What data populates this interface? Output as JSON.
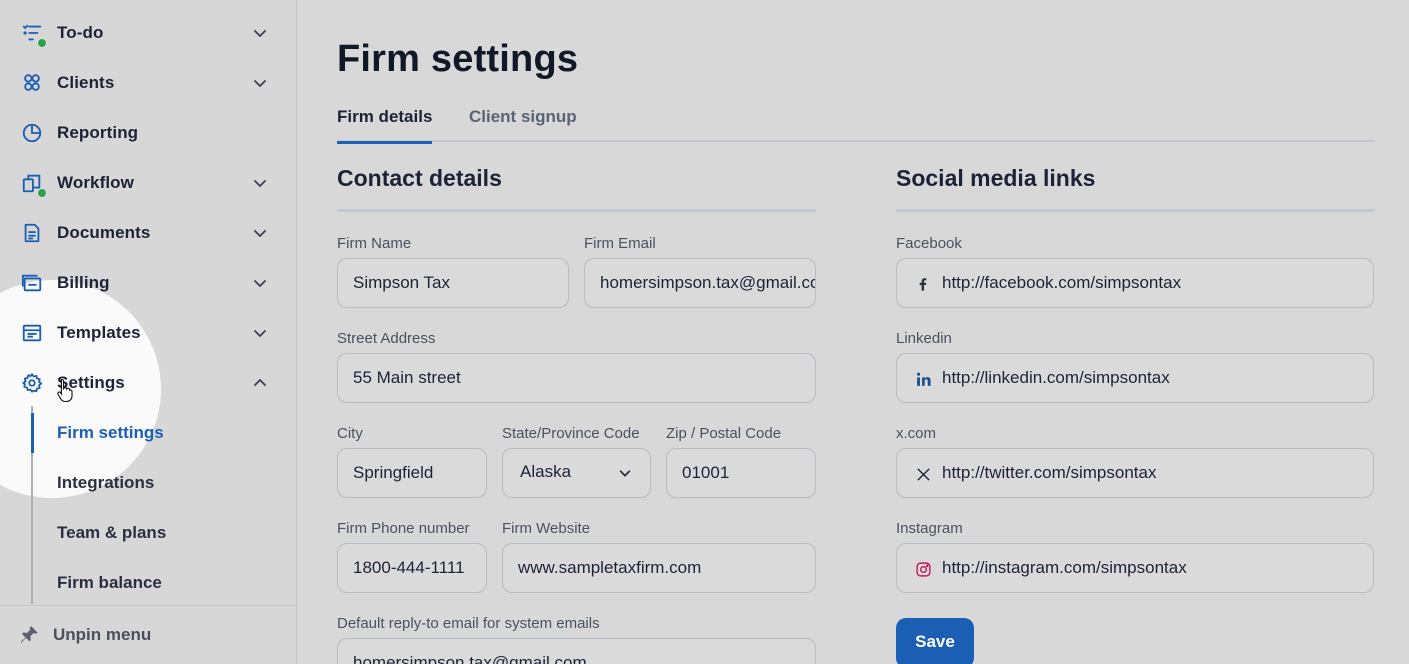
{
  "sidebar": {
    "items": [
      {
        "label": "To-do",
        "icon": "todo-list-icon",
        "has_chevron": true,
        "badge": "green-dot"
      },
      {
        "label": "Clients",
        "icon": "clients-icon",
        "has_chevron": true
      },
      {
        "label": "Reporting",
        "icon": "pie-chart-icon",
        "has_chevron": false
      },
      {
        "label": "Workflow",
        "icon": "workflow-icon",
        "has_chevron": true,
        "badge": "green-dot"
      },
      {
        "label": "Documents",
        "icon": "document-icon",
        "has_chevron": true
      },
      {
        "label": "Billing",
        "icon": "billing-icon",
        "has_chevron": true
      },
      {
        "label": "Templates",
        "icon": "templates-icon",
        "has_chevron": true
      },
      {
        "label": "Settings",
        "icon": "gear-icon",
        "has_chevron": true,
        "expanded": true
      }
    ],
    "settings_sub": [
      {
        "label": "Firm settings",
        "active": true
      },
      {
        "label": "Integrations"
      },
      {
        "label": "Team & plans"
      },
      {
        "label": "Firm balance"
      }
    ],
    "unpin_label": "Unpin menu"
  },
  "main": {
    "title": "Firm settings",
    "tabs": [
      {
        "label": "Firm details",
        "active": true
      },
      {
        "label": "Client signup"
      }
    ],
    "contact": {
      "title": "Contact details",
      "firm_name_label": "Firm Name",
      "firm_name": "Simpson Tax",
      "firm_email_label": "Firm Email",
      "firm_email": "homersimpson.tax@gmail.com",
      "street_label": "Street Address",
      "street": "55 Main street",
      "city_label": "City",
      "city": "Springfield",
      "state_label": "State/Province Code",
      "state": "Alaska",
      "zip_label": "Zip / Postal Code",
      "zip": "01001",
      "phone_label": "Firm Phone number",
      "phone": "1800-444-1111",
      "website_label": "Firm Website",
      "website": "www.sampletaxfirm.com",
      "reply_label": "Default reply-to email for system emails",
      "reply": "homersimpson.tax@gmail.com"
    },
    "social": {
      "title": "Social media links",
      "facebook_label": "Facebook",
      "facebook": "http://facebook.com/simpsontax",
      "linkedin_label": "Linkedin",
      "linkedin": "http://linkedin.com/simpsontax",
      "x_label": "x.com",
      "x": "http://twitter.com/simpsontax",
      "instagram_label": "Instagram",
      "instagram": "http://instagram.com/simpsontax"
    },
    "save_label": "Save"
  },
  "colors": {
    "accent": "#1a5fb4",
    "background": "#d8d8d8",
    "badge_green": "#2aa24c"
  }
}
